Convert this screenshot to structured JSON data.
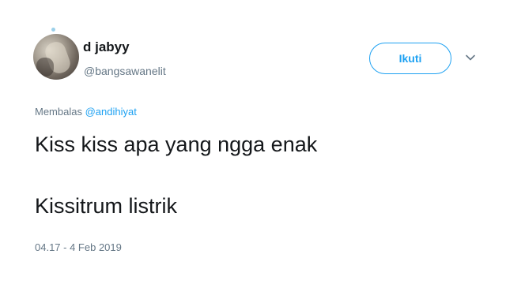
{
  "user": {
    "display_name": "d jabyy",
    "handle": "@bangsawanelit"
  },
  "follow_button": {
    "label": "Ikuti"
  },
  "menu": {
    "icon": "chevron-down-icon"
  },
  "reply_context": {
    "prefix": "Membalas",
    "mention": "@andihiyat"
  },
  "tweet": {
    "line1": "Kiss kiss apa yang ngga enak",
    "line2": "Kissitrum listrik",
    "timestamp": "04.17 - 4 Feb 2019"
  },
  "colors": {
    "accent": "#1da1f2",
    "secondary_text": "#657786",
    "primary_text": "#14171a"
  }
}
